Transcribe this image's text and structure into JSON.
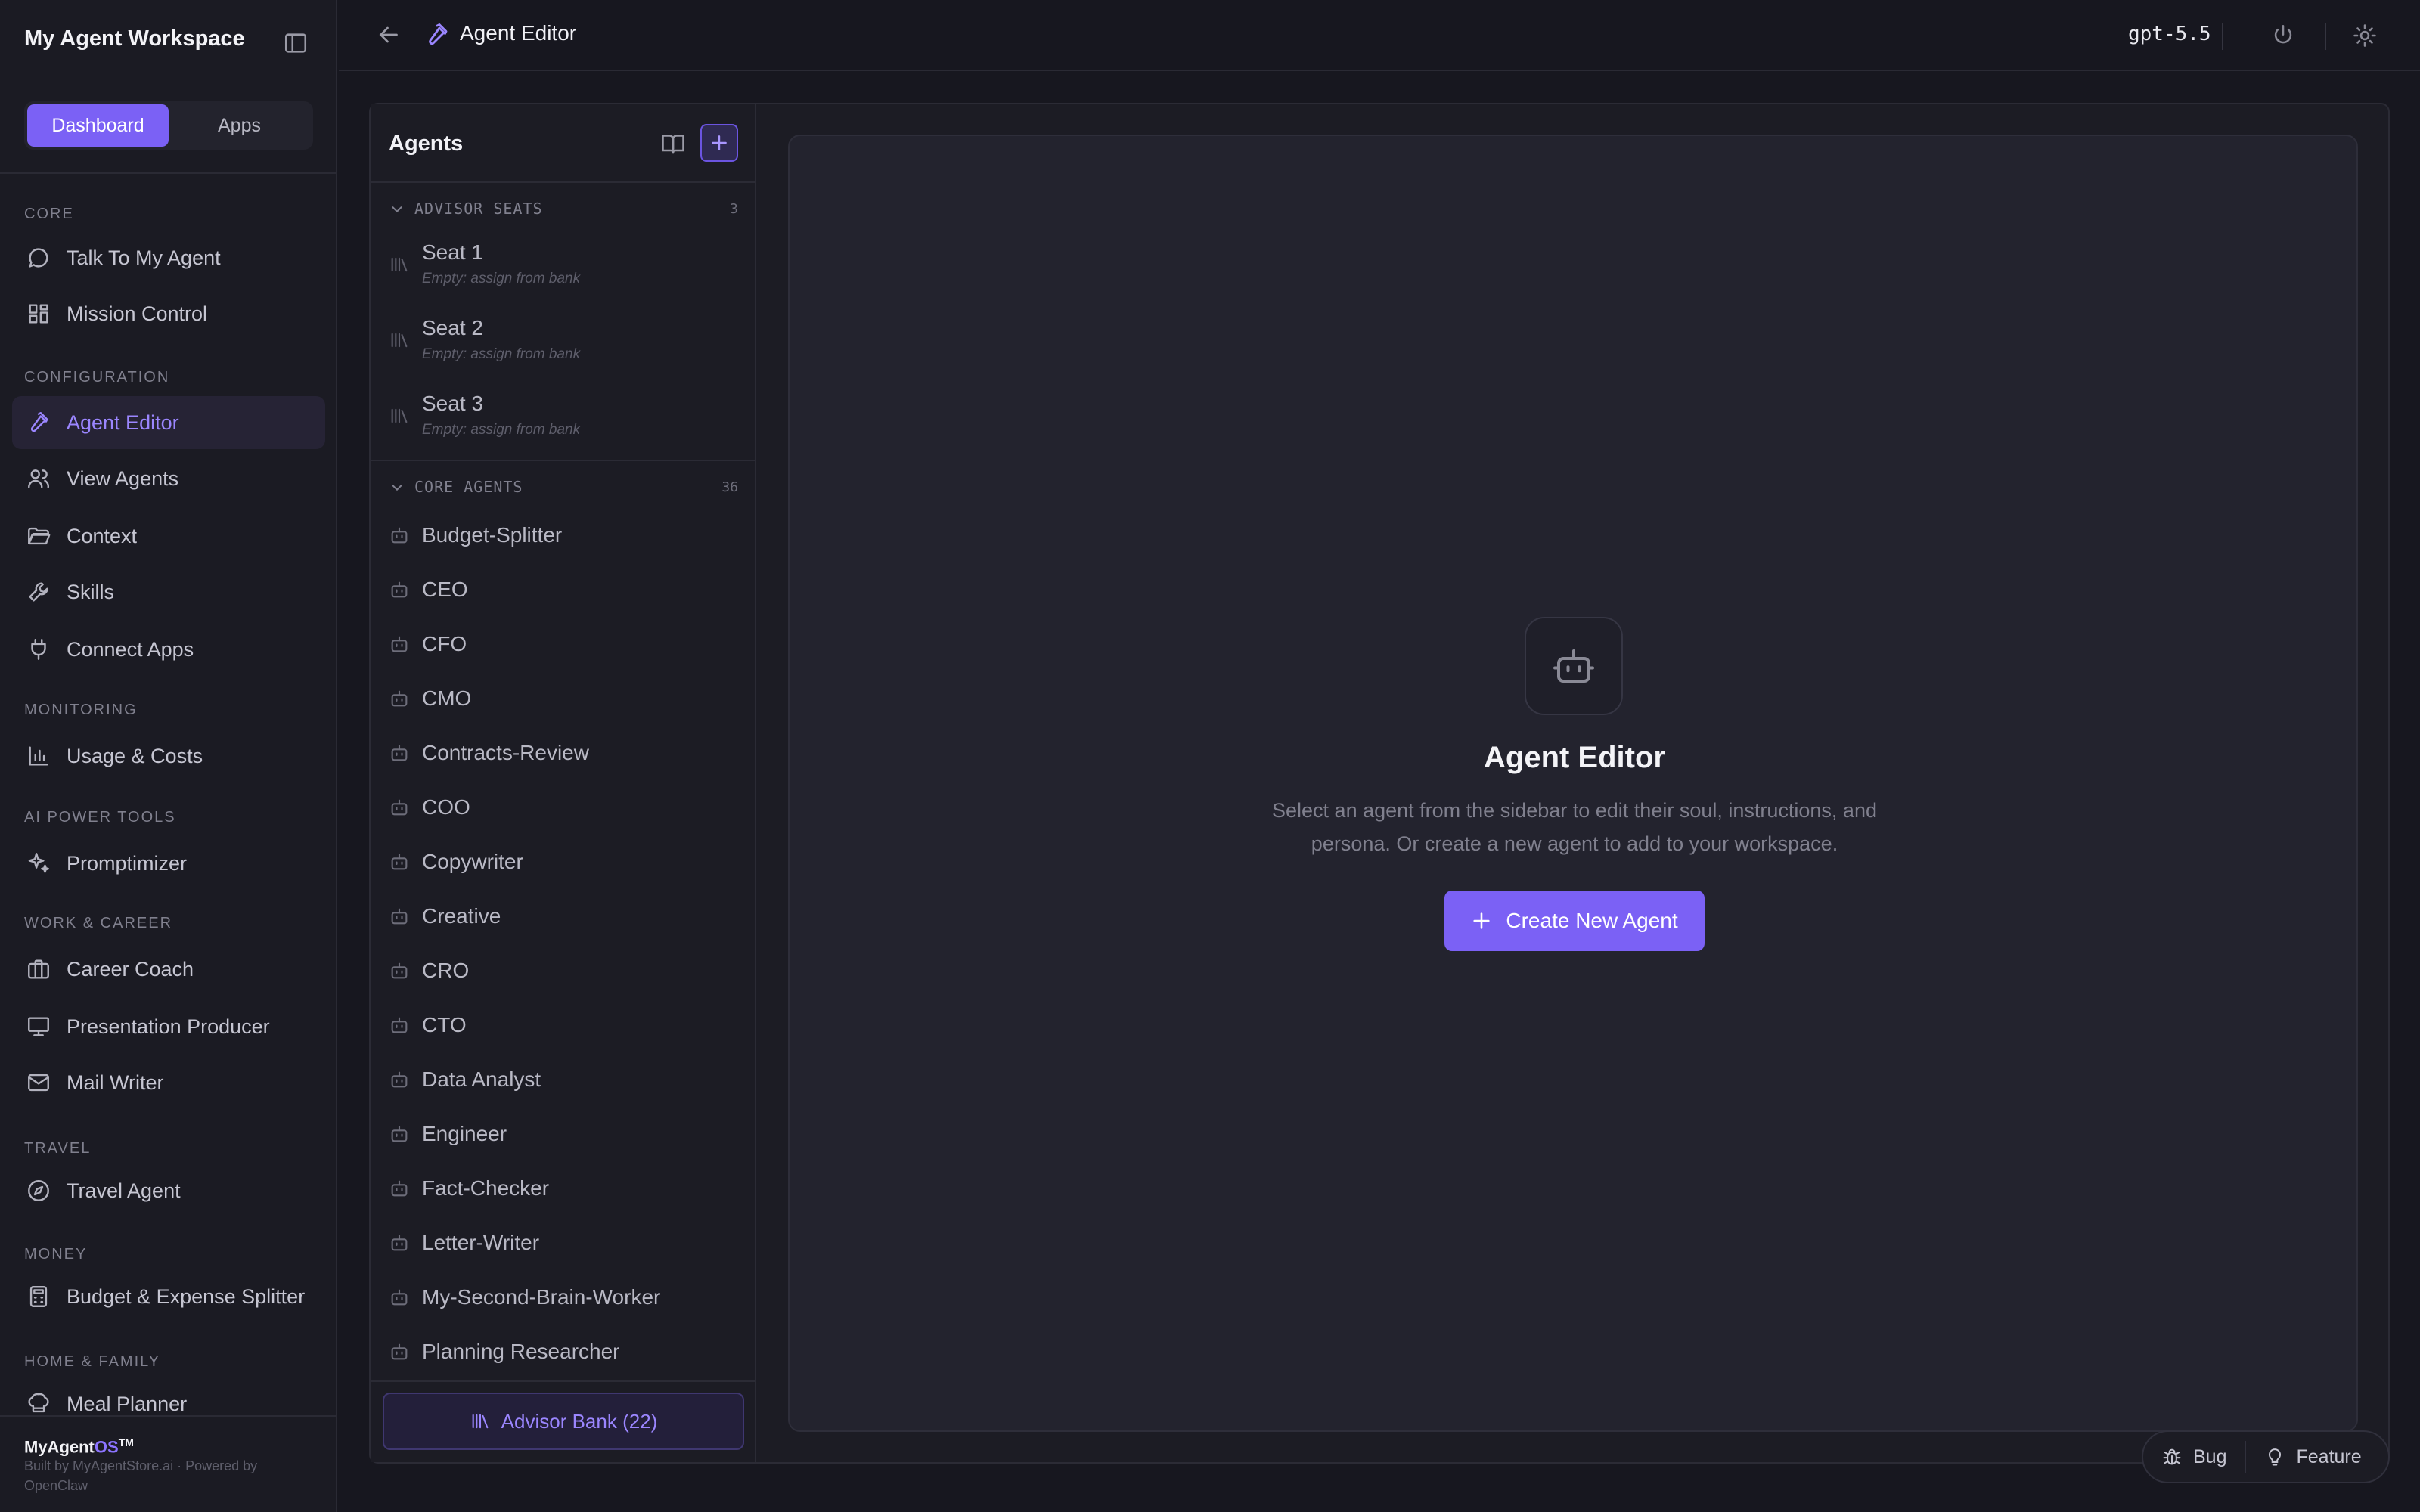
{
  "sidebar": {
    "workspace_title": "My Agent Workspace",
    "mode_tabs": [
      "Dashboard",
      "Apps"
    ],
    "sections": [
      {
        "label": "CORE",
        "items": [
          "Talk To My Agent",
          "Mission Control"
        ]
      },
      {
        "label": "CONFIGURATION",
        "items": [
          "Agent Editor",
          "View Agents",
          "Context",
          "Skills",
          "Connect Apps"
        ]
      },
      {
        "label": "MONITORING",
        "items": [
          "Usage & Costs"
        ]
      },
      {
        "label": "AI POWER TOOLS",
        "items": [
          "Promptimizer"
        ]
      },
      {
        "label": "WORK & CAREER",
        "items": [
          "Career Coach",
          "Presentation Producer",
          "Mail Writer"
        ]
      },
      {
        "label": "TRAVEL",
        "items": [
          "Travel Agent"
        ]
      },
      {
        "label": "MONEY",
        "items": [
          "Budget & Expense Splitter"
        ]
      },
      {
        "label": "HOME & FAMILY",
        "items": [
          "Meal Planner"
        ]
      }
    ],
    "active_item": "Agent Editor",
    "brand": {
      "name": "MyAgent",
      "suffix": "OS",
      "tm": "TM"
    },
    "built_by": "Built by MyAgentStore.ai · Powered by OpenClaw"
  },
  "topbar": {
    "title": "Agent Editor",
    "model": "gpt-5.5"
  },
  "agents_panel": {
    "title": "Agents",
    "advisor_group": {
      "label": "ADVISOR SEATS",
      "count": "3"
    },
    "seats": [
      {
        "name": "Seat 1",
        "sub": "Empty: assign from bank"
      },
      {
        "name": "Seat 2",
        "sub": "Empty: assign from bank"
      },
      {
        "name": "Seat 3",
        "sub": "Empty: assign from bank"
      }
    ],
    "core_group": {
      "label": "CORE AGENTS",
      "count": "36"
    },
    "agents": [
      "Budget-Splitter",
      "CEO",
      "CFO",
      "CMO",
      "Contracts-Review",
      "COO",
      "Copywriter",
      "Creative",
      "CRO",
      "CTO",
      "Data Analyst",
      "Engineer",
      "Fact-Checker",
      "Letter-Writer",
      "My-Second-Brain-Worker",
      "Planning Researcher"
    ],
    "advisor_bank_label": "Advisor Bank (22)"
  },
  "editor": {
    "title": "Agent Editor",
    "description": "Select an agent from the sidebar to edit their soul, instructions, and persona. Or create a new agent to add to your workspace.",
    "create_label": "Create New Agent"
  },
  "feedback": {
    "bug_label": "Bug",
    "feature_label": "Feature"
  },
  "colors": {
    "accent": "#7b61f5",
    "background": "#17171f",
    "panel": "#1c1c24"
  },
  "icons": {
    "Talk To My Agent": "chat-icon",
    "Mission Control": "grid-icon",
    "Agent Editor": "hammer-icon",
    "View Agents": "users-icon",
    "Context": "folder-icon",
    "Skills": "wrench-icon",
    "Connect Apps": "plug-icon",
    "Usage & Costs": "bar-chart-icon",
    "Promptimizer": "sparkles-icon",
    "Career Coach": "briefcase-icon",
    "Presentation Producer": "presentation-icon",
    "Mail Writer": "mail-icon",
    "Travel Agent": "compass-icon",
    "Budget & Expense Splitter": "calculator-icon",
    "Meal Planner": "chef-hat-icon"
  }
}
